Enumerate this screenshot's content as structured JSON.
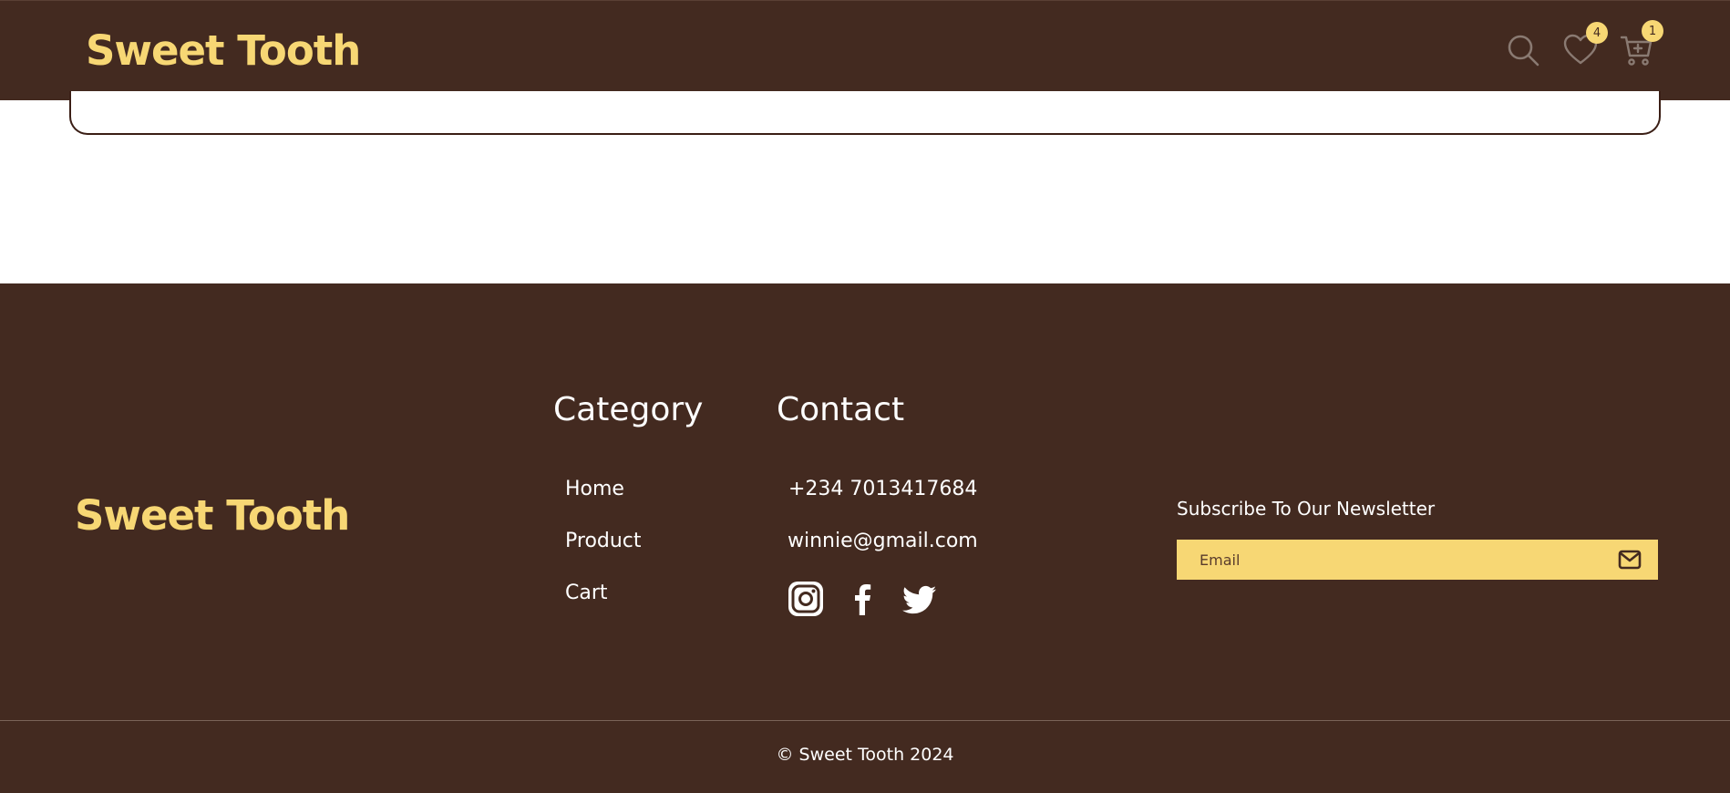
{
  "header": {
    "logo": "Sweet Tooth",
    "wishlist_count": "4",
    "cart_count": "1",
    "icons": [
      "search-icon",
      "heart-icon",
      "cart-icon"
    ]
  },
  "footer": {
    "logo": "Sweet Tooth",
    "category": {
      "heading": "Category",
      "links": [
        "Home",
        "Product",
        "Cart"
      ]
    },
    "contact": {
      "heading": "Contact",
      "phone": "+234 7013417684",
      "email": "winnie@gmail.com",
      "social_icons": [
        "instagram-icon",
        "facebook-icon",
        "twitter-icon"
      ]
    },
    "newsletter": {
      "label": "Subscribe To Our Newsletter",
      "placeholder": "Email",
      "value": ""
    },
    "copyright": "© Sweet Tooth 2024"
  },
  "colors": {
    "brown": "#432a20",
    "yellow": "#f7d774",
    "white": "#ffffff"
  }
}
